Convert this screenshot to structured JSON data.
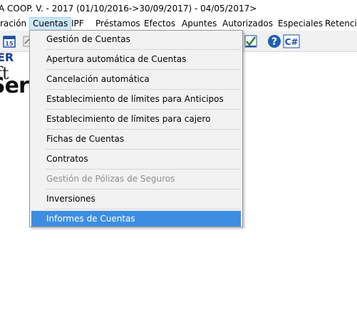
{
  "window": {
    "title": "A COOP. V. - 2017 (01/10/2016->30/09/2017) - 04/05/2017>"
  },
  "menubar": {
    "items": [
      {
        "label": "ración"
      },
      {
        "label": "Cuentas"
      },
      {
        "label": "IPF"
      },
      {
        "label": "Préstamos"
      },
      {
        "label": "Efectos"
      },
      {
        "label": "Apuntes"
      },
      {
        "label": "Autorizados"
      },
      {
        "label": "Especiales"
      },
      {
        "label": "Retencio"
      }
    ],
    "active": "Cuentas"
  },
  "toolbar": {
    "help_icon_text": "?",
    "csharp_label": "C#"
  },
  "logo": {
    "line1": "ER",
    "line2": "ft",
    "line3": "Serv"
  },
  "dropdown": {
    "items": [
      {
        "label": "Gestión de Cuentas",
        "state": "enabled"
      },
      {
        "label": "Apertura automática de Cuentas",
        "state": "enabled"
      },
      {
        "label": "Cancelación automática",
        "state": "enabled"
      },
      {
        "label": "Establecimiento de límites para Anticipos",
        "state": "enabled"
      },
      {
        "label": "Establecimiento de límites para cajero",
        "state": "enabled"
      },
      {
        "label": "Fichas de Cuentas",
        "state": "enabled"
      },
      {
        "label": "Contratos",
        "state": "enabled"
      },
      {
        "label": "Gestión de Pólizas de Seguros",
        "state": "disabled"
      },
      {
        "label": "Inversiones",
        "state": "enabled"
      },
      {
        "label": "Informes de Cuentas",
        "state": "highlighted"
      }
    ]
  },
  "colors": {
    "menu_active_bg": "#cce8ff",
    "dropdown_bg": "#f2f2f2",
    "highlight_bg": "#3d8ee0",
    "disabled_text": "#8d8d8d"
  }
}
